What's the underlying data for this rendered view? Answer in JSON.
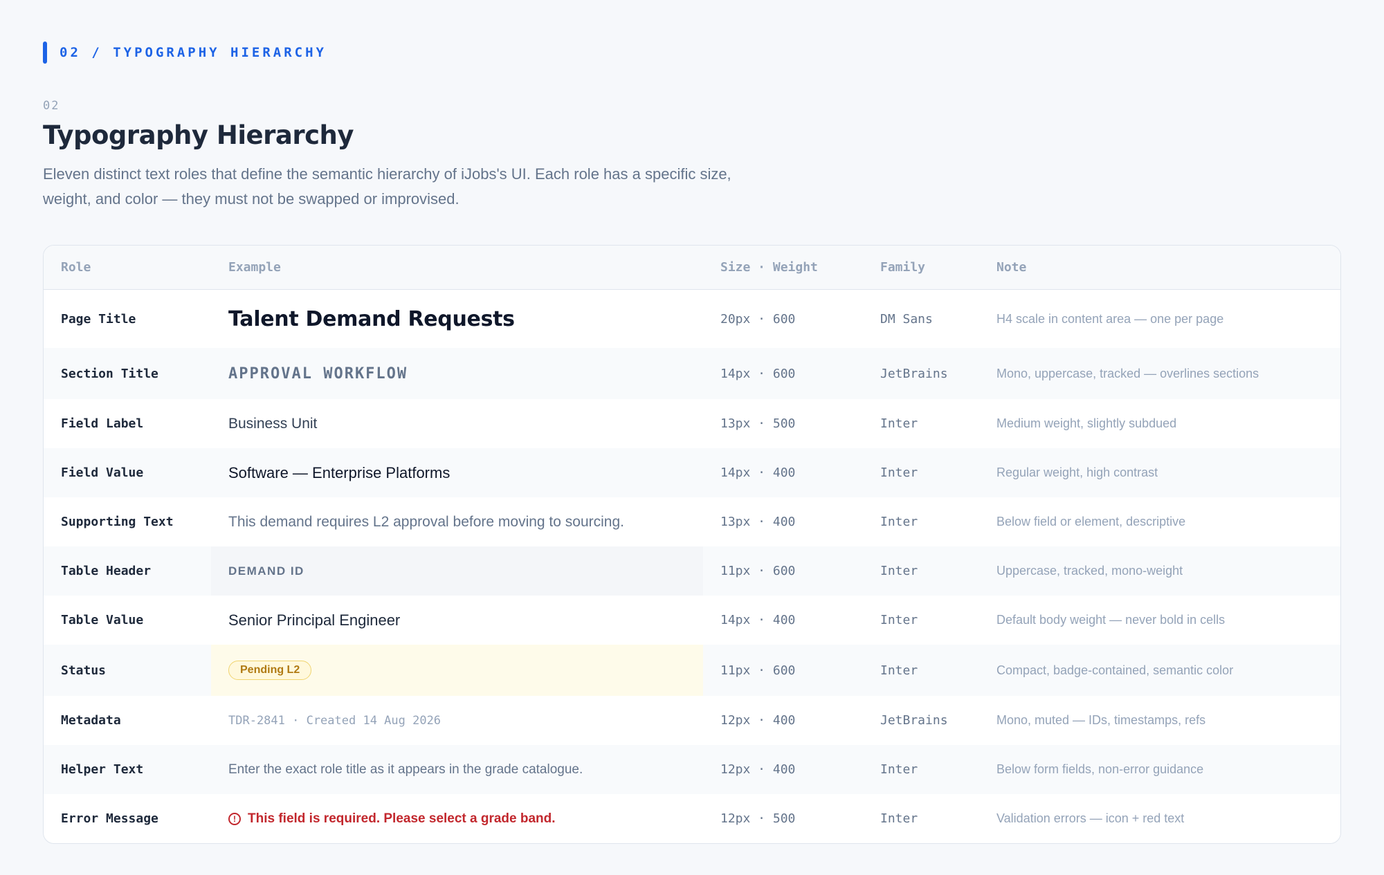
{
  "overline": {
    "label": "02 / TYPOGRAPHY HIERARCHY",
    "accent": "#1d63e6"
  },
  "section": {
    "number": "02",
    "title": "Typography Hierarchy",
    "description": "Eleven distinct text roles that define the semantic hierarchy of iJobs's UI. Each role has a specific size, weight, and color — they must not be swapped or improvised."
  },
  "table": {
    "headers": {
      "role": "Role",
      "example": "Example",
      "size_weight": "Size · Weight",
      "family": "Family",
      "note": "Note"
    },
    "rows": [
      {
        "role": "Page Title",
        "example": "Talent Demand Requests",
        "size": "20px · 600",
        "family": "DM Sans",
        "note": "H4 scale in content area — one per page"
      },
      {
        "role": "Section Title",
        "example": "APPROVAL WORKFLOW",
        "size": "14px · 600",
        "family": "JetBrains",
        "note": "Mono, uppercase, tracked — overlines sections"
      },
      {
        "role": "Field Label",
        "example": "Business Unit",
        "size": "13px · 500",
        "family": "Inter",
        "note": "Medium weight, slightly subdued"
      },
      {
        "role": "Field Value",
        "example": "Software — Enterprise Platforms",
        "size": "14px · 400",
        "family": "Inter",
        "note": "Regular weight, high contrast"
      },
      {
        "role": "Supporting Text",
        "example": "This demand requires L2 approval before moving to sourcing.",
        "size": "13px · 400",
        "family": "Inter",
        "note": "Below field or element, descriptive"
      },
      {
        "role": "Table Header",
        "example": "DEMAND ID",
        "size": "11px · 600",
        "family": "Inter",
        "note": "Uppercase, tracked, mono-weight"
      },
      {
        "role": "Table Value",
        "example": "Senior Principal Engineer",
        "size": "14px · 400",
        "family": "Inter",
        "note": "Default body weight — never bold in cells"
      },
      {
        "role": "Status",
        "example": "Pending L2",
        "size": "11px · 600",
        "family": "Inter",
        "note": "Compact, badge-contained, semantic color"
      },
      {
        "role": "Metadata",
        "example": "TDR-2841 · Created 14 Aug 2026",
        "size": "12px · 400",
        "family": "JetBrains",
        "note": "Mono, muted — IDs, timestamps, refs"
      },
      {
        "role": "Helper Text",
        "example": "Enter the exact role title as it appears in the grade catalogue.",
        "size": "12px · 400",
        "family": "Inter",
        "note": "Below form fields, non-error guidance"
      },
      {
        "role": "Error Message",
        "example": "This field is required. Please select a grade band.",
        "size": "12px · 500",
        "family": "Inter",
        "note": "Validation errors — icon + red text",
        "icon": "alert-circle-icon"
      }
    ]
  },
  "colors": {
    "status_pending_bg": "#fff8dc",
    "status_pending_text": "#b07a12",
    "error": "#c2272d"
  }
}
